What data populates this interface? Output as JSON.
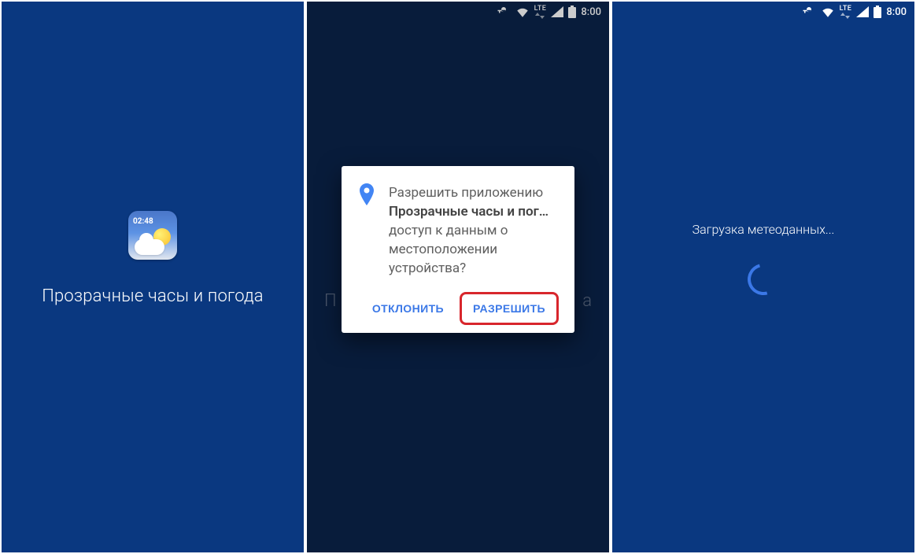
{
  "statusbar": {
    "lte": "LTE",
    "time": "8:00"
  },
  "screen1": {
    "app_title": "Прозрачные часы и погода",
    "widget_time": "02:48"
  },
  "screen2": {
    "bg_title_left": "П",
    "bg_title_right": "а",
    "dialog": {
      "line_prefix": "Разрешить приложению ",
      "app_name": "Прозрачные часы и пог…",
      "line_suffix": " доступ к данным о местоположении устройства?",
      "deny": "ОТКЛОНИТЬ",
      "allow": "РАЗРЕШИТЬ"
    }
  },
  "screen3": {
    "loading": "Загрузка метеоданных..."
  }
}
